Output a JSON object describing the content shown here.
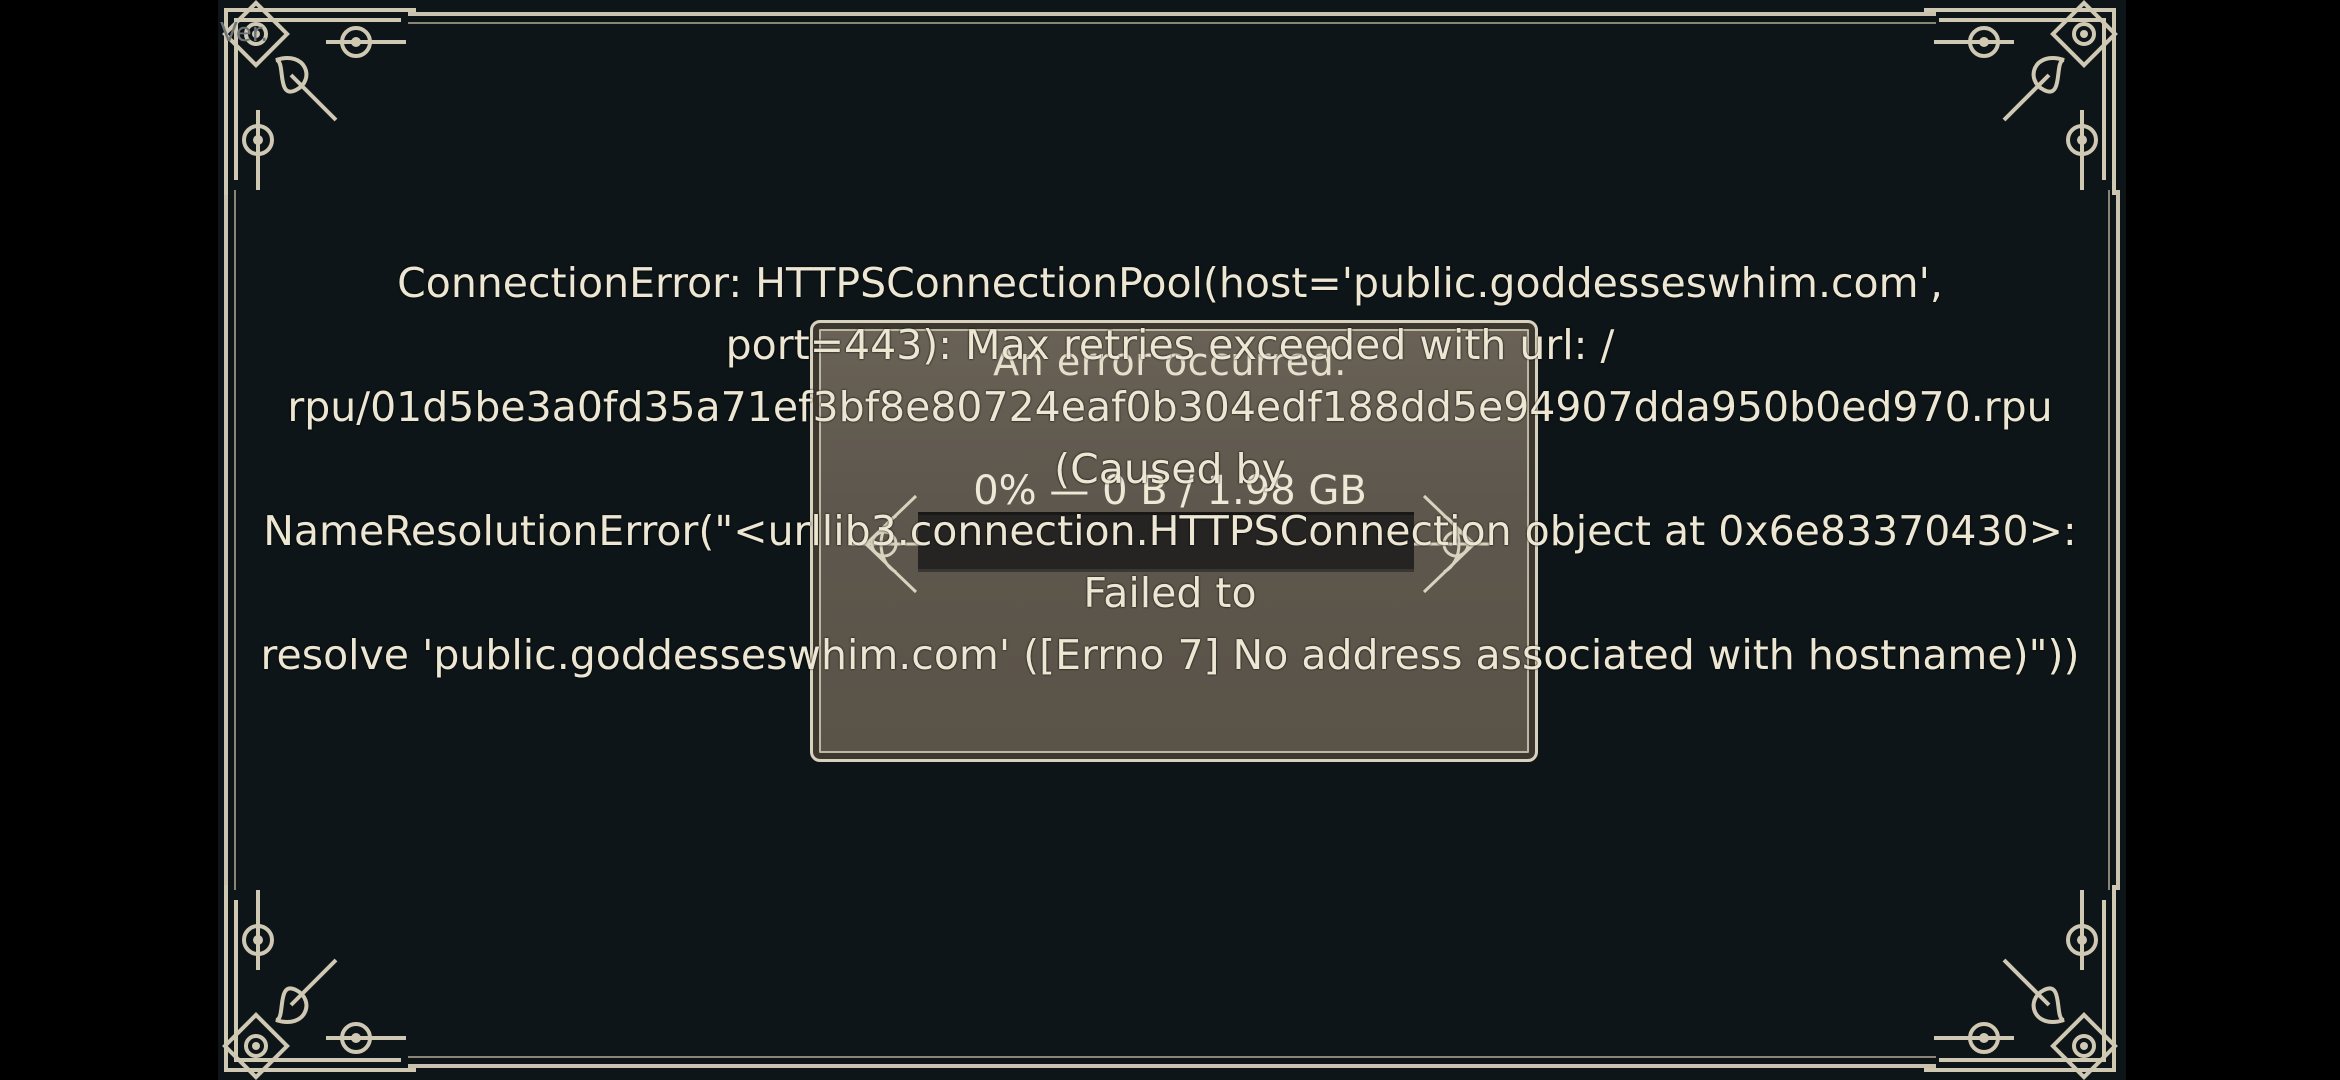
{
  "version_label": "Ver.",
  "dialog": {
    "title": "An error occurred.",
    "progress_text": "0% — 0 B / 1.98 GB",
    "progress_fraction": 0
  },
  "error": {
    "message": "ConnectionError: HTTPSConnectionPool(host='public.goddesseswhim.com',\nport=443): Max retries exceeded with url: /\nrpu/01d5be3a0fd35a71ef3bf8e80724eaf0b304edf188dd5e94907dda950b0ed970.rpu (Caused by\nNameResolutionError(\"<urllib3.connection.HTTPSConnection object at 0x6e83370430>: Failed to\nresolve 'public.goddesseswhim.com' ([Errno 7] No address associated with hostname)\"))"
  },
  "colors": {
    "frame_bg": "#0d1518",
    "border": "#c9c2ae",
    "dialog_bg": "#6a6256",
    "text": "#ece6d3"
  },
  "icons": [
    "corner-ornament-icon",
    "bar-ornament-icon"
  ]
}
